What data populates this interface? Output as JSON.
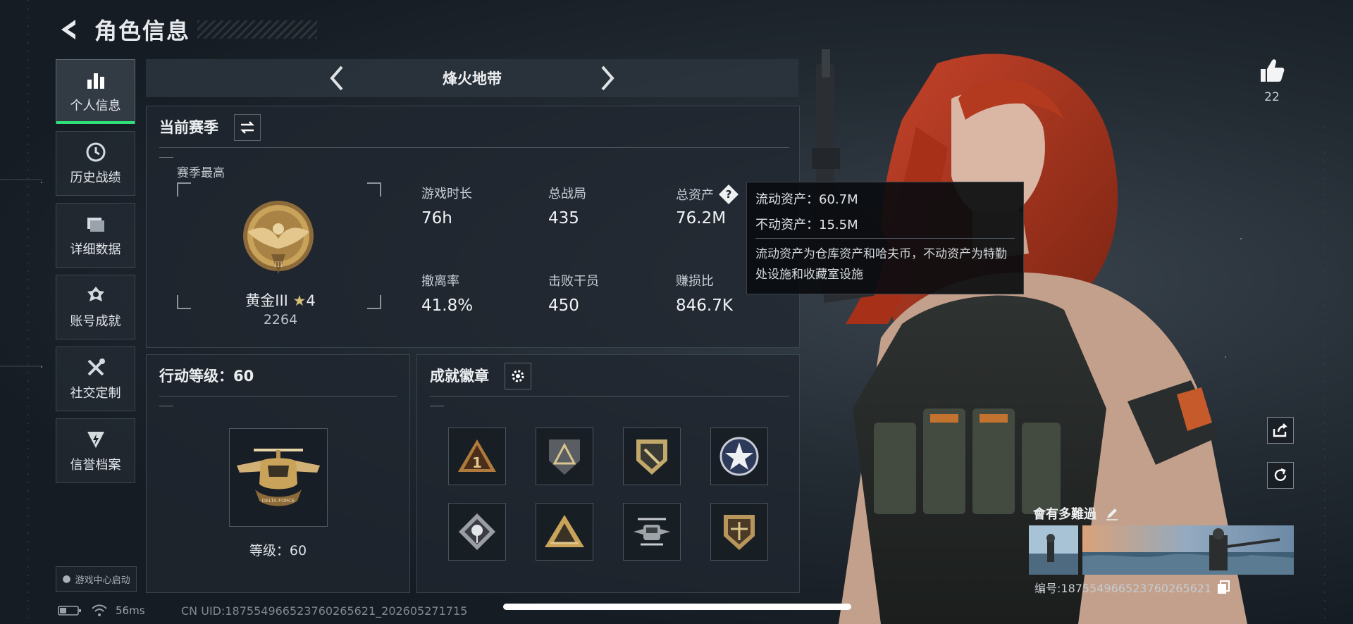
{
  "header": {
    "title": "角色信息"
  },
  "sidebar": {
    "items": [
      {
        "label": "个人信息",
        "icon": "bar-chart-icon",
        "active": true
      },
      {
        "label": "历史战绩",
        "icon": "history-clock-icon",
        "active": false
      },
      {
        "label": "详细数据",
        "icon": "folder-icon",
        "active": false
      },
      {
        "label": "账号成就",
        "icon": "medal-icon",
        "active": false
      },
      {
        "label": "社交定制",
        "icon": "tools-icon",
        "active": false
      },
      {
        "label": "信誉档案",
        "icon": "shield-bolt-icon",
        "active": false
      }
    ],
    "launch_tag": "游戏中心启动"
  },
  "mode": {
    "title": "烽火地带"
  },
  "season": {
    "title": "当前赛季",
    "best_label": "赛季最高",
    "rank_name": "黄金III",
    "rank_stars": "4",
    "rank_score": "2264",
    "stats": [
      {
        "label": "游戏时长",
        "value": "76h"
      },
      {
        "label": "总战局",
        "value": "435"
      },
      {
        "label": "总资产",
        "value": "76.2M"
      },
      {
        "label": "撤离率",
        "value": "41.8%"
      },
      {
        "label": "击败干员",
        "value": "450"
      },
      {
        "label": "赚损比",
        "value": "846.7K"
      }
    ]
  },
  "tooltip": {
    "liquid": "流动资产：60.7M",
    "fixed": "不动资产：15.5M",
    "desc": "流动资产为仓库资产和哈夫币，不动资产为特勤处设施和收藏室设施"
  },
  "level": {
    "title": "行动等级：60",
    "text": "等级：60"
  },
  "badges": {
    "title": "成就徽章",
    "items": [
      "badge-triangle-1",
      "badge-shield-triangle",
      "badge-shield-arrow",
      "badge-star-circle",
      "badge-rose",
      "badge-pyramid",
      "badge-helicopter",
      "badge-shield-wings"
    ]
  },
  "social": {
    "likes": "22"
  },
  "player": {
    "name": "會有多難過",
    "id": "编号:1875549665237602656​21"
  },
  "status": {
    "ping": "56ms",
    "uid": "CN UID:1875549665237602656​21_202605271715"
  },
  "colors": {
    "accent": "#2fe07a",
    "gold": "#c9a35a",
    "hair": "#b2361e"
  }
}
